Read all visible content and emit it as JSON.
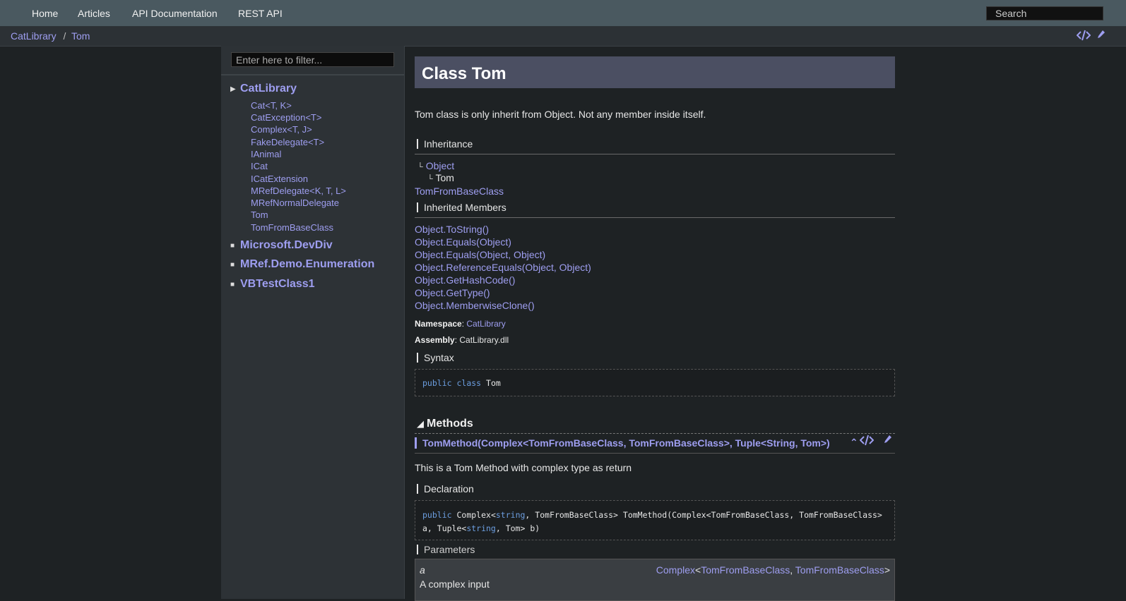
{
  "topnav": {
    "items": [
      "Home",
      "Articles",
      "API Documentation",
      "REST API"
    ],
    "search_placeholder": "Search"
  },
  "breadcrumb": {
    "items": [
      "CatLibrary",
      "Tom"
    ],
    "separator": "/"
  },
  "toc": {
    "filter_placeholder": "Enter here to filter...",
    "namespaces": [
      {
        "label": "CatLibrary",
        "expanded": true,
        "children": [
          "Cat<T, K>",
          "CatException<T>",
          "Complex<T, J>",
          "FakeDelegate<T>",
          "IAnimal",
          "ICat",
          "ICatExtension",
          "MRefDelegate<K, T, L>",
          "MRefNormalDelegate",
          "Tom",
          "TomFromBaseClass"
        ]
      },
      {
        "label": "Microsoft.DevDiv",
        "expanded": false
      },
      {
        "label": "MRef.Demo.Enumeration",
        "expanded": false
      },
      {
        "label": "VBTestClass1",
        "expanded": false
      }
    ]
  },
  "article": {
    "title": "Class Tom",
    "summary": "Tom class is only inherit from Object. Not any member inside itself.",
    "inheritance_label": "Inheritance",
    "inheritance": [
      "Object",
      "Tom"
    ],
    "derived": "TomFromBaseClass",
    "inherited_members_label": "Inherited Members",
    "inherited_members": [
      "Object.ToString()",
      "Object.Equals(Object)",
      "Object.Equals(Object, Object)",
      "Object.ReferenceEquals(Object, Object)",
      "Object.GetHashCode()",
      "Object.GetType()",
      "Object.MemberwiseClone()"
    ],
    "namespace_label": "Namespace",
    "namespace_value": "CatLibrary",
    "assembly_label": "Assembly",
    "assembly_value": "CatLibrary.dll",
    "syntax_label": "Syntax",
    "syntax_kw1": "public",
    "syntax_kw2": "class",
    "syntax_name": "Tom",
    "methods_label": "Methods",
    "method_title": "TomMethod(Complex<TomFromBaseClass, TomFromBaseClass>, Tuple<String, Tom>)",
    "method_summary": "This is a Tom Method with complex type as return",
    "declaration_label": "Declaration",
    "decl_line1_kw": "public",
    "decl_line1_a": "Complex<",
    "decl_line1_kw2": "string",
    "decl_line1_b": ", TomFromBaseClass> TomMethod(Complex<TomFromBaseClass, TomFromBaseClass>",
    "decl_line2_a": "a, Tuple<",
    "decl_line2_kw": "string",
    "decl_line2_b": ", Tom> b)",
    "parameters_label": "Parameters",
    "param_name": "a",
    "param_type_1": "Complex",
    "param_type_2": "TomFromBaseClass",
    "param_type_3": "TomFromBaseClass",
    "param_desc": "A complex input"
  },
  "icons": [
    "view-source-icon",
    "edit-icon",
    "triangle-right-icon",
    "square-bullet-icon",
    "collapse-icon",
    "caret-up-icon"
  ]
}
